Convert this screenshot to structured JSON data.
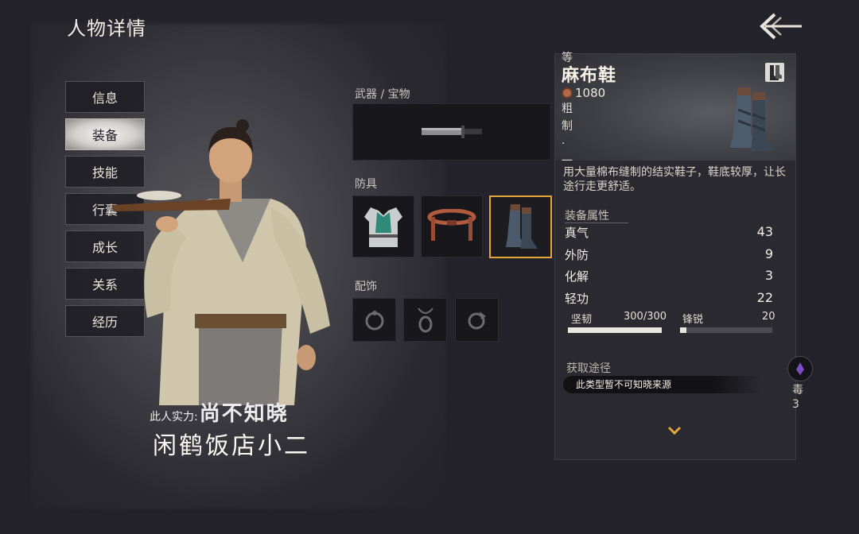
{
  "header": {
    "title": "人物详情"
  },
  "nav": [
    {
      "label": "信息",
      "active": false
    },
    {
      "label": "装备",
      "active": true
    },
    {
      "label": "技能",
      "active": false
    },
    {
      "label": "行囊",
      "active": false
    },
    {
      "label": "成长",
      "active": false
    },
    {
      "label": "关系",
      "active": false
    },
    {
      "label": "经历",
      "active": false
    }
  ],
  "character": {
    "strength_label": "此人实力:",
    "strength_value": "尚不知晓",
    "name": "闲鹤饭店小二"
  },
  "equipment": {
    "weapon_label": "武器 / 宝物",
    "armor_label": "防具",
    "accessory_label": "配饰",
    "weapon_icon": "dagger-icon",
    "armor_icons": [
      "vest-armor-icon",
      "belt-icon",
      "boots-icon"
    ],
    "accessory_icons": [
      "ring-icon",
      "pendant-icon",
      "amulet-icon"
    ]
  },
  "item_panel": {
    "grade_vertical": "等",
    "name": "麻布鞋",
    "price": "1080",
    "side_text": "粗制·一",
    "type_icon": "boot-type-icon",
    "description": "用大量棉布缝制的结实鞋子，鞋底较厚，让长途行走更舒适。",
    "attributes_title": "装备属性",
    "attributes": [
      {
        "name": "真气",
        "value": "43"
      },
      {
        "name": "外防",
        "value": "9"
      },
      {
        "name": "化解",
        "value": "3"
      },
      {
        "name": "轻功",
        "value": "22"
      }
    ],
    "durability": {
      "label": "坚韧",
      "value": "300/300",
      "fraction": 1.0
    },
    "sharpness": {
      "label": "锋锐",
      "value": "20",
      "fraction": 0.07
    },
    "source_title": "获取途径",
    "source_text": "此类型暂不可知晓来源"
  },
  "peek": {
    "text_1": "毒",
    "text_2": "3"
  },
  "colors": {
    "accent": "#e2a63a",
    "bg": "#24232b",
    "panel": "#2b2a31"
  }
}
